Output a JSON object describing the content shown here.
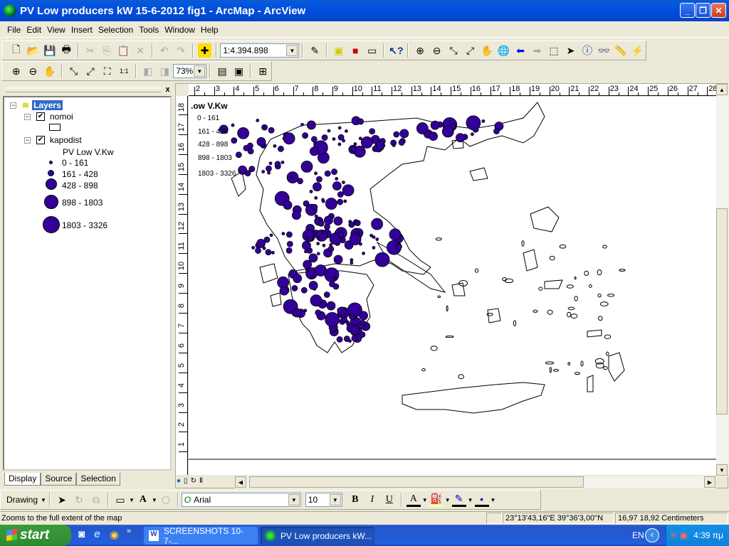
{
  "window": {
    "title": "PV Low producers kW 15-6-2012 fig1 - ArcMap - ArcView",
    "min": "_",
    "max": "❐",
    "close": "✕"
  },
  "menu": [
    "File",
    "Edit",
    "View",
    "Insert",
    "Selection",
    "Tools",
    "Window",
    "Help"
  ],
  "toolbar": {
    "scale": "1:4.394.898",
    "zoom_percent": "73%"
  },
  "toc": {
    "close": "x",
    "root": "Layers",
    "layers": [
      {
        "name": "nomoi",
        "checked": true
      },
      {
        "name": "kapodist",
        "checked": true,
        "field": "PV Low V.Kw",
        "classes": [
          "0 - 161",
          "161 - 428",
          "428 - 898",
          "898 - 1803",
          "1803 - 3326"
        ]
      }
    ],
    "tabs": [
      "Display",
      "Source",
      "Selection"
    ]
  },
  "map": {
    "legend_title": ".ow V.Kw",
    "legend_classes": [
      "0 - 161",
      "161 - 428",
      "428 - 898",
      "898 - 1803",
      "1803 - 3326"
    ],
    "symbol_color": "#330099",
    "hruler": [
      "2",
      "3",
      "4",
      "5",
      "6",
      "7",
      "8",
      "9",
      "10",
      "11",
      "12",
      "13",
      "14",
      "15",
      "16",
      "17",
      "18",
      "19",
      "20",
      "21",
      "22",
      "23",
      "24",
      "25",
      "26",
      "27",
      "28"
    ],
    "vruler": [
      "18",
      "17",
      "16",
      "15",
      "14",
      "13",
      "12",
      "11",
      "10",
      "9",
      "8",
      "7",
      "6",
      "5",
      "4",
      "3",
      "2",
      "1"
    ]
  },
  "drawing": {
    "label": "Drawing",
    "font": "Arial",
    "size": "10",
    "bold": "B",
    "italic": "I",
    "underline": "U",
    "font_color": "A"
  },
  "status": {
    "message": "Zooms to the full extent of the map",
    "coords": "23°13'43,16\"E  39°36'3,00\"N",
    "page_pos": "16,97  18,92 Centimeters"
  },
  "taskbar": {
    "start": "start",
    "tasks": [
      "SCREENSHOTS 10-7-...",
      "PV Low producers kW..."
    ],
    "lang": "EN",
    "clock": "4:39 πμ"
  }
}
